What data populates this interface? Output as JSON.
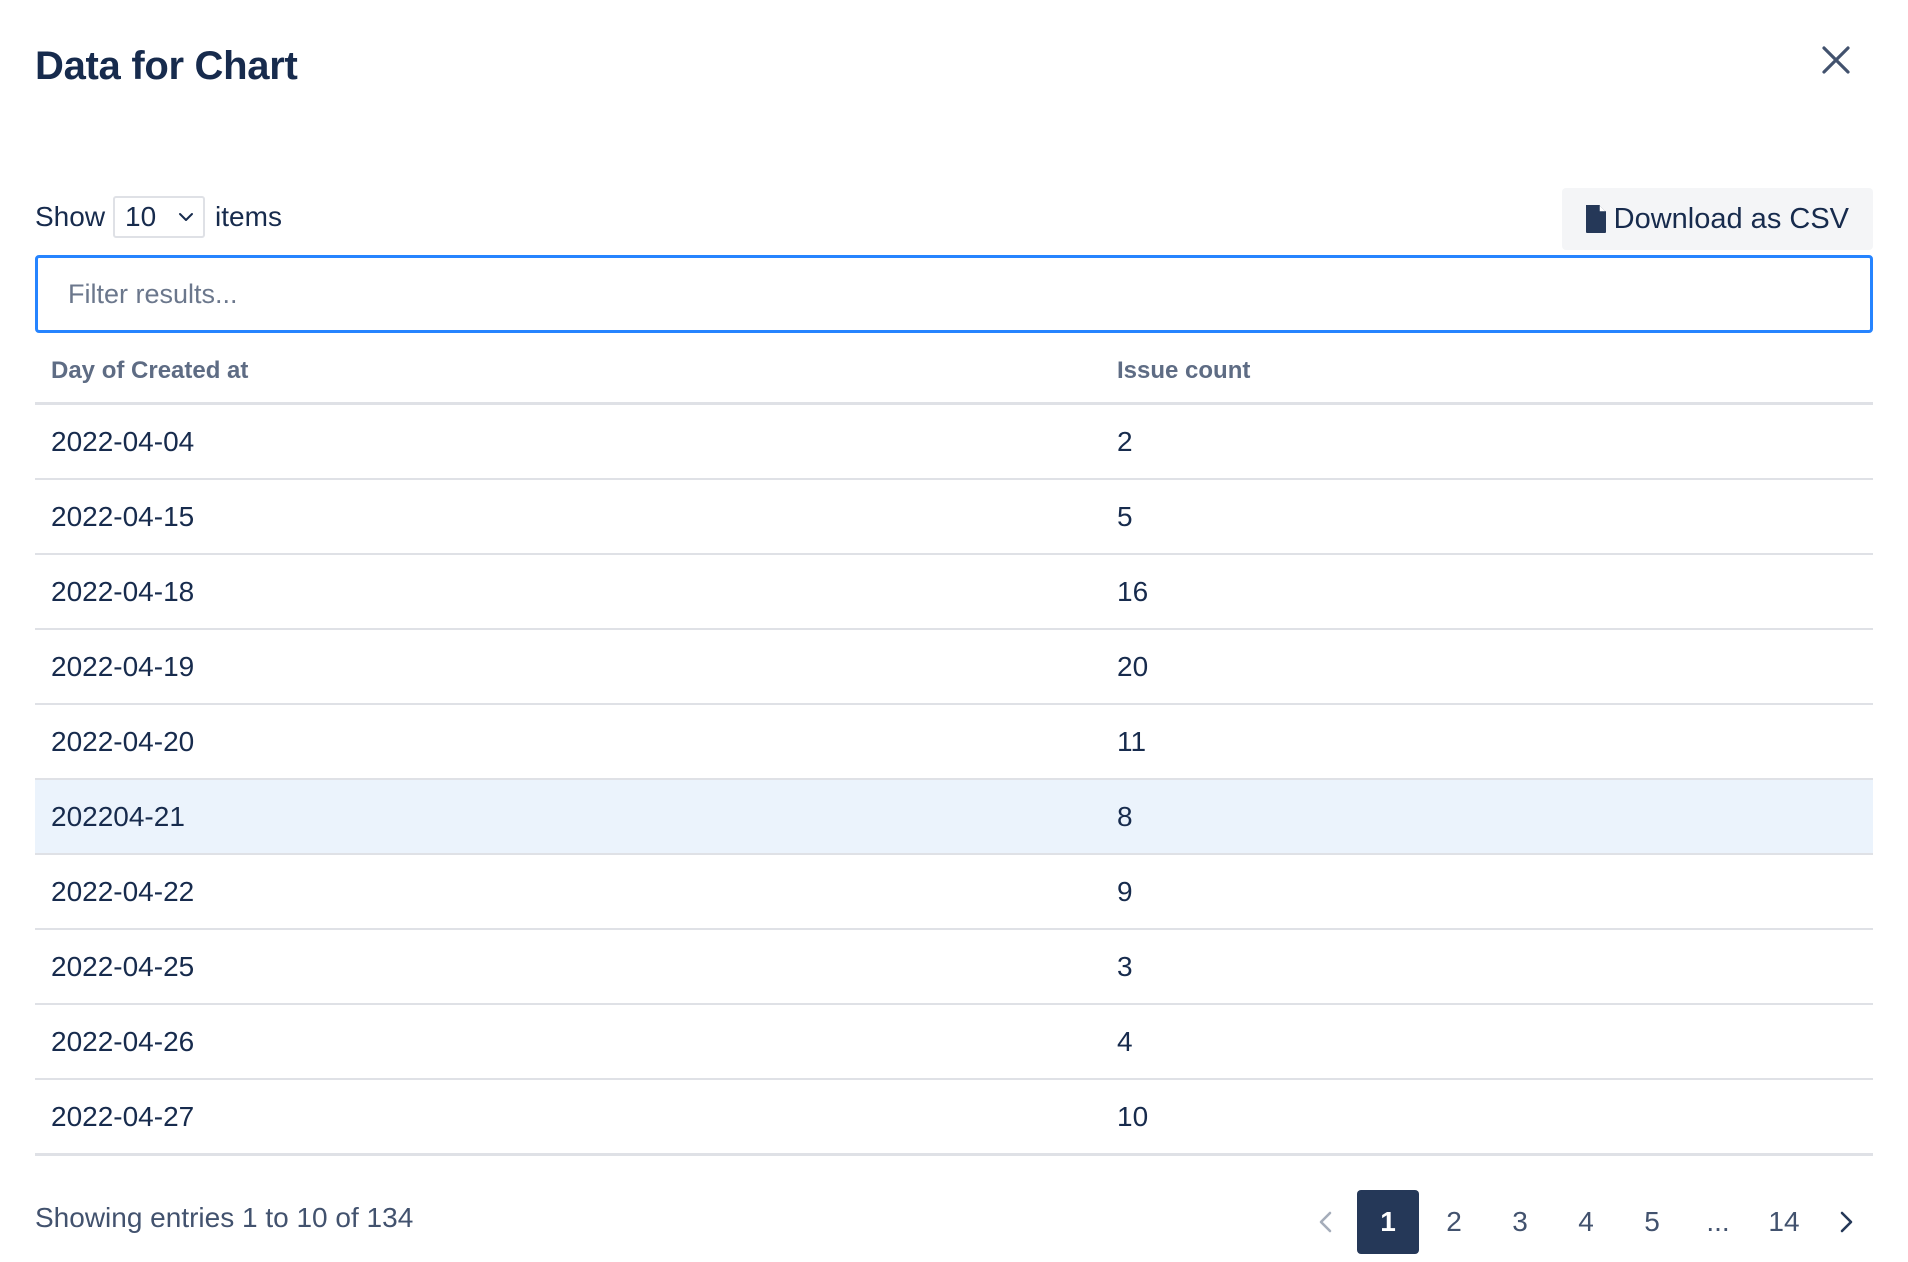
{
  "dialog": {
    "title": "Data for Chart"
  },
  "toolbar": {
    "show_label": "Show",
    "page_size": "10",
    "items_label": "items",
    "download_label": "Download as CSV"
  },
  "filter": {
    "placeholder": "Filter results...",
    "value": ""
  },
  "table": {
    "columns": [
      "Day of Created at",
      "Issue count"
    ],
    "rows": [
      [
        "2022-04-04",
        "2"
      ],
      [
        "2022-04-15",
        "5"
      ],
      [
        "2022-04-18",
        "16"
      ],
      [
        "2022-04-19",
        "20"
      ],
      [
        "2022-04-20",
        "11"
      ],
      [
        "202204-21",
        "8"
      ],
      [
        "2022-04-22",
        "9"
      ],
      [
        "2022-04-25",
        "3"
      ],
      [
        "2022-04-26",
        "4"
      ],
      [
        "2022-04-27",
        "10"
      ]
    ],
    "highlighted_row": 5
  },
  "footer": {
    "entries_text": "Showing entries 1 to 10 of 134"
  },
  "pagination": {
    "current": "1",
    "pages": [
      "1",
      "2",
      "3",
      "4",
      "5",
      "...",
      "14"
    ]
  },
  "colors": {
    "accent": "#2684FF",
    "active_page": "#253858",
    "row_highlight": "#EBF3FC"
  },
  "icons": {
    "close": "close-icon",
    "file": "file-icon",
    "chevron_down": "chevron-down-icon",
    "prev": "chevron-left-icon",
    "next": "chevron-right-icon"
  }
}
